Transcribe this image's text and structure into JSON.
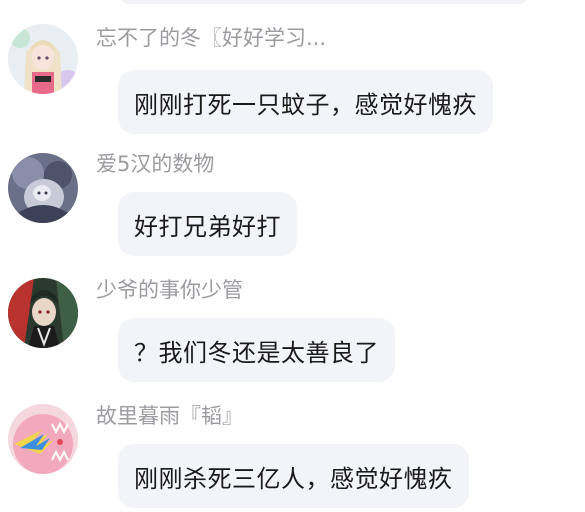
{
  "messages": [
    {
      "sender": "忘不了的冬〖好好学习...",
      "text": "刚刚打死一只蚊子，感觉好愧疚",
      "avatar_icon": "anime-girl-avatar-icon"
    },
    {
      "sender": "爱5汉的数物",
      "text": "好打兄弟好打",
      "avatar_icon": "anime-character-grey-avatar-icon"
    },
    {
      "sender": "少爷的事你少管",
      "text": "？我们冬还是太善良了",
      "avatar_icon": "anime-character-red-avatar-icon"
    },
    {
      "sender": "故里暮雨『韬』",
      "text": "刚刚杀死三亿人，感觉好愧疚",
      "avatar_icon": "pink-creature-avatar-icon"
    }
  ],
  "colors": {
    "bubble_bg": "#f3f4f8",
    "sender_text": "#9b9ba0",
    "message_text": "#1a1a1a"
  }
}
